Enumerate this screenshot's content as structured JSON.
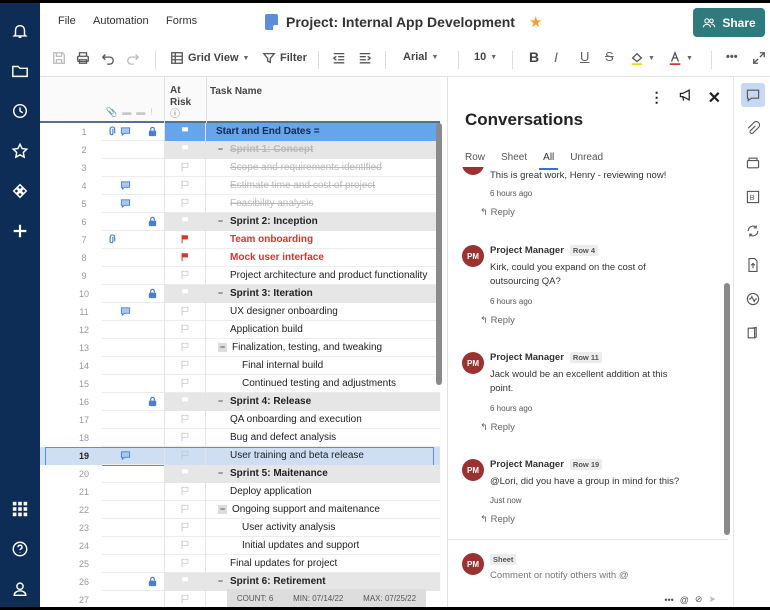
{
  "header": {
    "menu": [
      "File",
      "Automation",
      "Forms"
    ],
    "title": "Project: Internal App Development",
    "share_label": "Share"
  },
  "toolbar": {
    "view_label": "Grid View",
    "filter_label": "Filter",
    "font": "Arial",
    "font_size": "10"
  },
  "grid": {
    "col_at_risk": "At Risk",
    "col_task": "Task Name",
    "rows": [
      {
        "n": "1",
        "task": "Start and End Dates =",
        "type": "sel",
        "attach": true,
        "comment": true,
        "lock": true
      },
      {
        "n": "2",
        "task": "Sprint 1: Concept",
        "type": "group done",
        "minus": true
      },
      {
        "n": "3",
        "task": "Scope and requirements identified",
        "type": "done",
        "indent": 2
      },
      {
        "n": "4",
        "task": "Estimate time and cost of project",
        "type": "done",
        "indent": 2,
        "comment": true
      },
      {
        "n": "5",
        "task": "Feasibility analysis",
        "type": "done",
        "indent": 2,
        "comment": true
      },
      {
        "n": "6",
        "task": "Sprint 2: Inception",
        "type": "group",
        "minus": true,
        "lock": true
      },
      {
        "n": "7",
        "task": "Team onboarding",
        "type": "red",
        "indent": 2,
        "attach": true,
        "flag": true
      },
      {
        "n": "8",
        "task": "Mock user interface",
        "type": "red",
        "indent": 2,
        "flag": true
      },
      {
        "n": "9",
        "task": "Project architecture and product functionality",
        "type": "",
        "indent": 2
      },
      {
        "n": "10",
        "task": "Sprint 3: Iteration",
        "type": "group",
        "minus": true,
        "lock": true
      },
      {
        "n": "11",
        "task": "UX designer onboarding",
        "type": "",
        "indent": 2,
        "comment": true
      },
      {
        "n": "12",
        "task": "Application build",
        "type": "",
        "indent": 2
      },
      {
        "n": "13",
        "task": "Finalization, testing, and tweaking",
        "type": "",
        "indent": 1,
        "minus": true
      },
      {
        "n": "14",
        "task": "Final internal build",
        "type": "",
        "indent": 3
      },
      {
        "n": "15",
        "task": "Continued testing and adjustments",
        "type": "",
        "indent": 3
      },
      {
        "n": "16",
        "task": "Sprint 4: Release",
        "type": "group",
        "minus": true,
        "lock": true
      },
      {
        "n": "17",
        "task": "QA onboarding and execution",
        "type": "",
        "indent": 2
      },
      {
        "n": "18",
        "task": "Bug and defect analysis",
        "type": "",
        "indent": 2
      },
      {
        "n": "19",
        "task": "User training and beta release",
        "type": "active",
        "indent": 2,
        "comment": true
      },
      {
        "n": "20",
        "task": "Sprint 5: Maitenance",
        "type": "group",
        "minus": true
      },
      {
        "n": "21",
        "task": "Deploy application",
        "type": "",
        "indent": 2
      },
      {
        "n": "22",
        "task": "Ongoing support and maitenance",
        "type": "",
        "indent": 1,
        "minus": true
      },
      {
        "n": "23",
        "task": "User activity analysis",
        "type": "",
        "indent": 3
      },
      {
        "n": "24",
        "task": "Initial updates and support",
        "type": "",
        "indent": 3
      },
      {
        "n": "25",
        "task": "Final updates for project",
        "type": "",
        "indent": 2
      },
      {
        "n": "26",
        "task": "Sprint 6: Retirement",
        "type": "group",
        "minus": true,
        "lock": true
      },
      {
        "n": "27",
        "task": "",
        "type": ""
      }
    ],
    "summary": {
      "count": "COUNT: 6",
      "min": "MIN: 07/14/22",
      "max": "MAX: 07/25/22"
    }
  },
  "conversations": {
    "title": "Conversations",
    "tabs": [
      "Row",
      "Sheet",
      "All",
      "Unread"
    ],
    "active_tab": "All",
    "messages": [
      {
        "author": "",
        "row": "",
        "text": "This is great work, Henry - reviewing now!",
        "time": "6 hours ago",
        "reply": "Reply"
      },
      {
        "author": "Project Manager",
        "initials": "PM",
        "row": "Row 4",
        "text": "Kirk, could you expand on the cost of outsourcing QA?",
        "time": "6 hours ago",
        "reply": "Reply"
      },
      {
        "author": "Project Manager",
        "initials": "PM",
        "row": "Row 11",
        "text": "Jack would be an excellent addition at this point.",
        "time": "6 hours ago",
        "reply": "Reply"
      },
      {
        "author": "Project Manager",
        "initials": "PM",
        "row": "Row 19",
        "text": "@Lori, did you have a group in mind for this?",
        "time": "Just now",
        "reply": "Reply"
      }
    ],
    "composer": {
      "initials": "PM",
      "tag": "Sheet",
      "placeholder": "Comment or notify others with @"
    }
  },
  "colors": {
    "nav": "#0d2d57",
    "share": "#2f7a7d",
    "selected_row": "#66a4ec",
    "at_risk": "#d8352c",
    "avatar": "#9a3232"
  }
}
